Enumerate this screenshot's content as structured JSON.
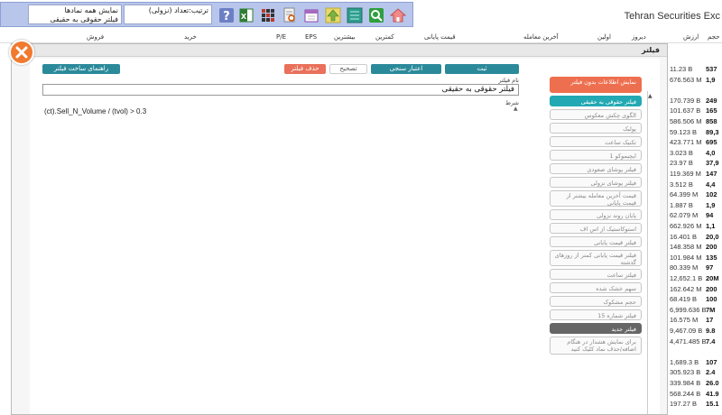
{
  "app": {
    "title": "Tehran Securities Exc"
  },
  "toolbar": {
    "sort_select": {
      "line1": "ترتیب:تعداد (نزولی)",
      "line2": ""
    },
    "show_select": {
      "line1": "نمایش همه نمادها",
      "line2": "فیلتر حقوقی به حقیقی"
    },
    "icons": [
      "help-icon",
      "excel-icon",
      "grid-icon",
      "report-icon",
      "calendar-icon",
      "up-arrow-icon",
      "sheet-icon",
      "search-icon",
      "home-icon"
    ]
  },
  "columns": [
    "حجم",
    "ارزش",
    "دیروز",
    "اولین",
    "آخرین معامله",
    "قیمت پایانی",
    "کمترین",
    "بیشترین",
    "EPS",
    "P/E",
    "خرید",
    "فروش"
  ],
  "modal": {
    "title": "فیلتر",
    "buttons": {
      "help": "راهنمای ساخت فیلتر",
      "delete": "حذف فیلتر",
      "edit": "تصحیح",
      "validate": "اعتبار سنجی",
      "save": "ثبت"
    },
    "name_label": "نام فیلتر",
    "name_value": "فیلتر حقوقی به حقیقی",
    "condition_label": "شرط",
    "condition_value": "(ct).Sell_N_Volume / (tvol) > 0.3"
  },
  "filters": [
    {
      "label": "نمایش اطلاعات بدون فیلتر",
      "style": "orange"
    },
    {
      "label": "فیلتر حقوقی به حقیقی",
      "style": "teal"
    },
    {
      "label": "الگوی چکش معکوس",
      "style": "normal"
    },
    {
      "label": "پولبک",
      "style": "normal"
    },
    {
      "label": "تکنیک ساعت",
      "style": "normal"
    },
    {
      "label": "ایچیموکو 1",
      "style": "normal"
    },
    {
      "label": "فیلتر پوشای صعودی",
      "style": "normal"
    },
    {
      "label": "فیلتر پوشای نزولی",
      "style": "normal"
    },
    {
      "label": "قیمت آخرین معامله بیشتر از قیمت پایانی",
      "style": "normal"
    },
    {
      "label": "پایان روند نزولی",
      "style": "normal"
    },
    {
      "label": "استوکاستیک از اس اف",
      "style": "normal"
    },
    {
      "label": "فیلتر قیمت پایانی",
      "style": "normal"
    },
    {
      "label": "فیلتر قیمت پایانی کمتر از روزهای گذشته",
      "style": "normal"
    },
    {
      "label": "فیلتر ساعت",
      "style": "normal"
    },
    {
      "label": "سهم خشک شده",
      "style": "normal"
    },
    {
      "label": "حجم مشکوک",
      "style": "normal"
    },
    {
      "label": "فیلتر شماره 15",
      "style": "normal"
    },
    {
      "label": "فیلتر جدید",
      "style": "dark"
    },
    {
      "label": "برای نمایش هشدار در هنگام اضافه/حذف نماد کلیک کنید",
      "style": "normal"
    }
  ],
  "right_rows": [
    {
      "a": "11.23 B",
      "b": "537"
    },
    {
      "a": "676.563 M",
      "b": "1,9"
    },
    {
      "a": "",
      "b": ""
    },
    {
      "a": "170.739 B",
      "b": "249"
    },
    {
      "a": "101.637 B",
      "b": "165"
    },
    {
      "a": "586.506 M",
      "b": "858"
    },
    {
      "a": "59.123 B",
      "b": "89,3"
    },
    {
      "a": "423.771 M",
      "b": "695"
    },
    {
      "a": "3.023 B",
      "b": "4,0"
    },
    {
      "a": "23.97 B",
      "b": "37,9"
    },
    {
      "a": "119.369 M",
      "b": "147"
    },
    {
      "a": "3.512 B",
      "b": "4,4"
    },
    {
      "a": "64.399 M",
      "b": "102"
    },
    {
      "a": "1.887 B",
      "b": "1,9"
    },
    {
      "a": "62.079 M",
      "b": "94"
    },
    {
      "a": "662.926 M",
      "b": "1,1"
    },
    {
      "a": "16.401 B",
      "b": "20,0"
    },
    {
      "a": "148.358 M",
      "b": "200"
    },
    {
      "a": "101.984 M",
      "b": "135"
    },
    {
      "a": "80.339 M",
      "b": "97"
    },
    {
      "a": "12,652.1 B",
      "b": "20M"
    },
    {
      "a": "162.642 M",
      "b": "200"
    },
    {
      "a": "68.419 B",
      "b": "100"
    },
    {
      "a": "6,999.636 B",
      "b": "7M"
    },
    {
      "a": "16.575 M",
      "b": "17"
    },
    {
      "a": "9,467.09 B",
      "b": "9.8"
    },
    {
      "a": "4,471.485 B",
      "b": "7.4"
    },
    {
      "a": "",
      "b": ""
    },
    {
      "a": "1,689.3 B",
      "b": "107"
    },
    {
      "a": "305.923 B",
      "b": "2.4"
    },
    {
      "a": "339.984 B",
      "b": "26.0"
    },
    {
      "a": "568.244 B",
      "b": "41.9"
    },
    {
      "a": "197.27 B",
      "b": "15.1"
    }
  ]
}
